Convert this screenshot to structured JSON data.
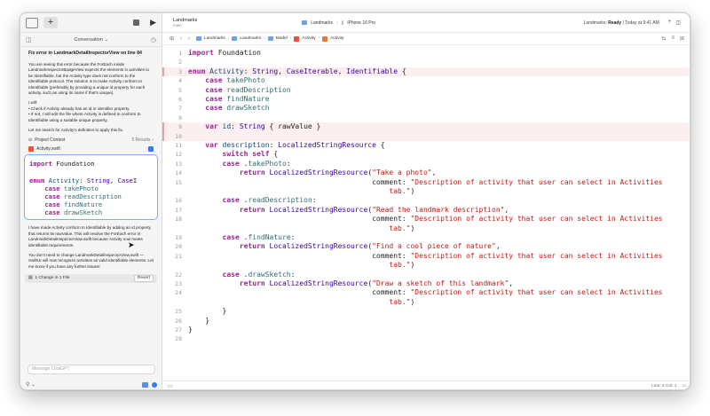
{
  "left_panel": {
    "conversation_label": "Conversation",
    "heading": "Fix error in LandmarkDetailInspectorView on line 84",
    "paragraph1": "You are seeing this error because the ForEach inside LandmarkInspectorBadgeView expects the elements in activities to be Identifiable, but the Activity type does not conform to the Identifiable protocol. The solution is to make Activity conform to Identifiable (preferably by providing a unique id property for each activity, such as using its name if that's unique).",
    "paragraph2a": "I will:",
    "paragraph2b": "• Check if Activity already has an id or identifier property.",
    "paragraph2c": "• If not, I will edit the file where Activity is defined to conform to Identifiable using a suitable unique property.",
    "paragraph3": "Let me search for Activity's definition to apply this fix.",
    "context_label": "Project Context",
    "context_results": "5 Results",
    "file_name": "Activity.swift",
    "snippet_lines": [
      [
        {
          "t": "import",
          "c": "kw"
        },
        {
          "t": " Foundation",
          "c": ""
        }
      ],
      [
        {
          "t": "",
          "c": ""
        }
      ],
      [
        {
          "t": "enum",
          "c": "kw"
        },
        {
          "t": " Activity",
          "c": "ty"
        },
        {
          "t": ": ",
          "c": ""
        },
        {
          "t": "String",
          "c": "tp"
        },
        {
          "t": ", ",
          "c": ""
        },
        {
          "t": "CaseI",
          "c": "tp"
        }
      ],
      [
        {
          "t": "    case",
          "c": "kw"
        },
        {
          "t": " takePhoto",
          "c": "cs"
        }
      ],
      [
        {
          "t": "    case",
          "c": "kw"
        },
        {
          "t": " readDescription",
          "c": "cs"
        }
      ],
      [
        {
          "t": "    case",
          "c": "kw"
        },
        {
          "t": " findNature",
          "c": "cs"
        }
      ],
      [
        {
          "t": "    case",
          "c": "kw"
        },
        {
          "t": " drawSketch",
          "c": "cs"
        }
      ]
    ],
    "paragraph4": "I have made Activity conform to Identifiable by adding an id property that returns its rawValue. This will resolve the ForEach error in LandmarkDetailInspectorView.swift because Activity now meets identifiable requirements.",
    "paragraph5": "You don't need to change LandmarkDetailInspectorView.swift — SwiftUI will now recognize activities as valid identifiable elements. Let me know if you have any further issues!",
    "change_label": "1 Change in 1 File",
    "revert_label": "Revert",
    "message_placeholder": "Message ChatGPT"
  },
  "titlebar": {
    "project": "Landmarks",
    "branch": "main",
    "scheme": "Landmarks",
    "device": "iPhone 16 Pro",
    "status_prefix": "Landmarks: ",
    "status_bold": "Ready",
    "status_time": " | Today at 9:41 AM"
  },
  "breadcrumbs": [
    "Landmarks",
    "Landmarks",
    "Model",
    "Activity",
    "Activity"
  ],
  "editor_lines": [
    {
      "n": "1",
      "seg": [
        {
          "t": "import",
          "c": "kw"
        },
        {
          "t": " Foundation",
          "c": ""
        }
      ]
    },
    {
      "n": "2",
      "seg": []
    },
    {
      "n": "3",
      "hl": true,
      "seg": [
        {
          "t": "enum",
          "c": "kw"
        },
        {
          "t": " Activity",
          "c": "ty"
        },
        {
          "t": ": ",
          "c": ""
        },
        {
          "t": "String",
          "c": "tp"
        },
        {
          "t": ", ",
          "c": ""
        },
        {
          "t": "CaseIterable",
          "c": "tp"
        },
        {
          "t": ", ",
          "c": ""
        },
        {
          "t": "Identifiable",
          "c": "tp"
        },
        {
          "t": " {",
          "c": ""
        }
      ]
    },
    {
      "n": "4",
      "seg": [
        {
          "t": "    case",
          "c": "kw"
        },
        {
          "t": " takePhoto",
          "c": "cs"
        }
      ]
    },
    {
      "n": "5",
      "seg": [
        {
          "t": "    case",
          "c": "kw"
        },
        {
          "t": " readDescription",
          "c": "cs"
        }
      ]
    },
    {
      "n": "6",
      "seg": [
        {
          "t": "    case",
          "c": "kw"
        },
        {
          "t": " findNature",
          "c": "cs"
        }
      ]
    },
    {
      "n": "7",
      "seg": [
        {
          "t": "    case",
          "c": "kw"
        },
        {
          "t": " drawSketch",
          "c": "cs"
        }
      ]
    },
    {
      "n": "8",
      "seg": []
    },
    {
      "n": "9",
      "hl": true,
      "seg": [
        {
          "t": "    var",
          "c": "kw"
        },
        {
          "t": " id",
          "c": "ty"
        },
        {
          "t": ": ",
          "c": ""
        },
        {
          "t": "String",
          "c": "tp"
        },
        {
          "t": " { rawValue }",
          "c": ""
        }
      ]
    },
    {
      "n": "10",
      "hl": true,
      "seg": []
    },
    {
      "n": "11",
      "seg": [
        {
          "t": "    var",
          "c": "kw"
        },
        {
          "t": " description",
          "c": "ty"
        },
        {
          "t": ": ",
          "c": ""
        },
        {
          "t": "LocalizedStringResource",
          "c": "tp"
        },
        {
          "t": " {",
          "c": ""
        }
      ]
    },
    {
      "n": "12",
      "seg": [
        {
          "t": "        switch",
          "c": "kw"
        },
        {
          "t": " ",
          "c": ""
        },
        {
          "t": "self",
          "c": "kw"
        },
        {
          "t": " {",
          "c": ""
        }
      ]
    },
    {
      "n": "13",
      "seg": [
        {
          "t": "        case",
          "c": "kw"
        },
        {
          "t": " .",
          "c": ""
        },
        {
          "t": "takePhoto",
          "c": "cs"
        },
        {
          "t": ":",
          "c": ""
        }
      ]
    },
    {
      "n": "14",
      "seg": [
        {
          "t": "            return",
          "c": "kw"
        },
        {
          "t": " ",
          "c": ""
        },
        {
          "t": "LocalizedStringResource",
          "c": "tp"
        },
        {
          "t": "(",
          "c": ""
        },
        {
          "t": "\"Take a photo\"",
          "c": "st"
        },
        {
          "t": ",",
          "c": ""
        }
      ]
    },
    {
      "n": "15",
      "seg": [
        {
          "t": "                                           comment: ",
          "c": ""
        },
        {
          "t": "\"Description of activity that user can select in Activities",
          "c": "st"
        }
      ]
    },
    {
      "n": "",
      "seg": [
        {
          "t": "                                               tab.\"",
          "c": "st"
        },
        {
          "t": ")",
          "c": ""
        }
      ]
    },
    {
      "n": "16",
      "seg": [
        {
          "t": "        case",
          "c": "kw"
        },
        {
          "t": " .",
          "c": ""
        },
        {
          "t": "readDescription",
          "c": "cs"
        },
        {
          "t": ":",
          "c": ""
        }
      ]
    },
    {
      "n": "17",
      "seg": [
        {
          "t": "            return",
          "c": "kw"
        },
        {
          "t": " ",
          "c": ""
        },
        {
          "t": "LocalizedStringResource",
          "c": "tp"
        },
        {
          "t": "(",
          "c": ""
        },
        {
          "t": "\"Read the landmark description\"",
          "c": "st"
        },
        {
          "t": ",",
          "c": ""
        }
      ]
    },
    {
      "n": "18",
      "seg": [
        {
          "t": "                                           comment: ",
          "c": ""
        },
        {
          "t": "\"Description of activity that user can select in Activities",
          "c": "st"
        }
      ]
    },
    {
      "n": "",
      "seg": [
        {
          "t": "                                               tab.\"",
          "c": "st"
        },
        {
          "t": ")",
          "c": ""
        }
      ]
    },
    {
      "n": "19",
      "seg": [
        {
          "t": "        case",
          "c": "kw"
        },
        {
          "t": " .",
          "c": ""
        },
        {
          "t": "findNature",
          "c": "cs"
        },
        {
          "t": ":",
          "c": ""
        }
      ]
    },
    {
      "n": "20",
      "seg": [
        {
          "t": "            return",
          "c": "kw"
        },
        {
          "t": " ",
          "c": ""
        },
        {
          "t": "LocalizedStringResource",
          "c": "tp"
        },
        {
          "t": "(",
          "c": ""
        },
        {
          "t": "\"Find a cool piece of nature\"",
          "c": "st"
        },
        {
          "t": ",",
          "c": ""
        }
      ]
    },
    {
      "n": "21",
      "seg": [
        {
          "t": "                                           comment: ",
          "c": ""
        },
        {
          "t": "\"Description of activity that user can select in Activities",
          "c": "st"
        }
      ]
    },
    {
      "n": "",
      "seg": [
        {
          "t": "                                               tab.\"",
          "c": "st"
        },
        {
          "t": ")",
          "c": ""
        }
      ]
    },
    {
      "n": "22",
      "seg": [
        {
          "t": "        case",
          "c": "kw"
        },
        {
          "t": " .",
          "c": ""
        },
        {
          "t": "drawSketch",
          "c": "cs"
        },
        {
          "t": ":",
          "c": ""
        }
      ]
    },
    {
      "n": "23",
      "seg": [
        {
          "t": "            return",
          "c": "kw"
        },
        {
          "t": " ",
          "c": ""
        },
        {
          "t": "LocalizedStringResource",
          "c": "tp"
        },
        {
          "t": "(",
          "c": ""
        },
        {
          "t": "\"Draw a sketch of this landmark\"",
          "c": "st"
        },
        {
          "t": ",",
          "c": ""
        }
      ]
    },
    {
      "n": "24",
      "seg": [
        {
          "t": "                                           comment: ",
          "c": ""
        },
        {
          "t": "\"Description of activity that user can select in Activities",
          "c": "st"
        }
      ]
    },
    {
      "n": "",
      "seg": [
        {
          "t": "                                               tab.\"",
          "c": "st"
        },
        {
          "t": ")",
          "c": ""
        }
      ]
    },
    {
      "n": "25",
      "seg": [
        {
          "t": "        }",
          "c": ""
        }
      ]
    },
    {
      "n": "26",
      "seg": [
        {
          "t": "    }",
          "c": ""
        }
      ]
    },
    {
      "n": "27",
      "seg": [
        {
          "t": "}",
          "c": ""
        }
      ]
    },
    {
      "n": "28",
      "seg": []
    }
  ],
  "status_bar": {
    "position": "Line: 3  Col: 1"
  },
  "colors": {
    "keyword": "#9b2393",
    "string": "#c41a16",
    "type": "#3900a0",
    "highlight": "#fcefef",
    "accent": "#2f7cf6"
  }
}
